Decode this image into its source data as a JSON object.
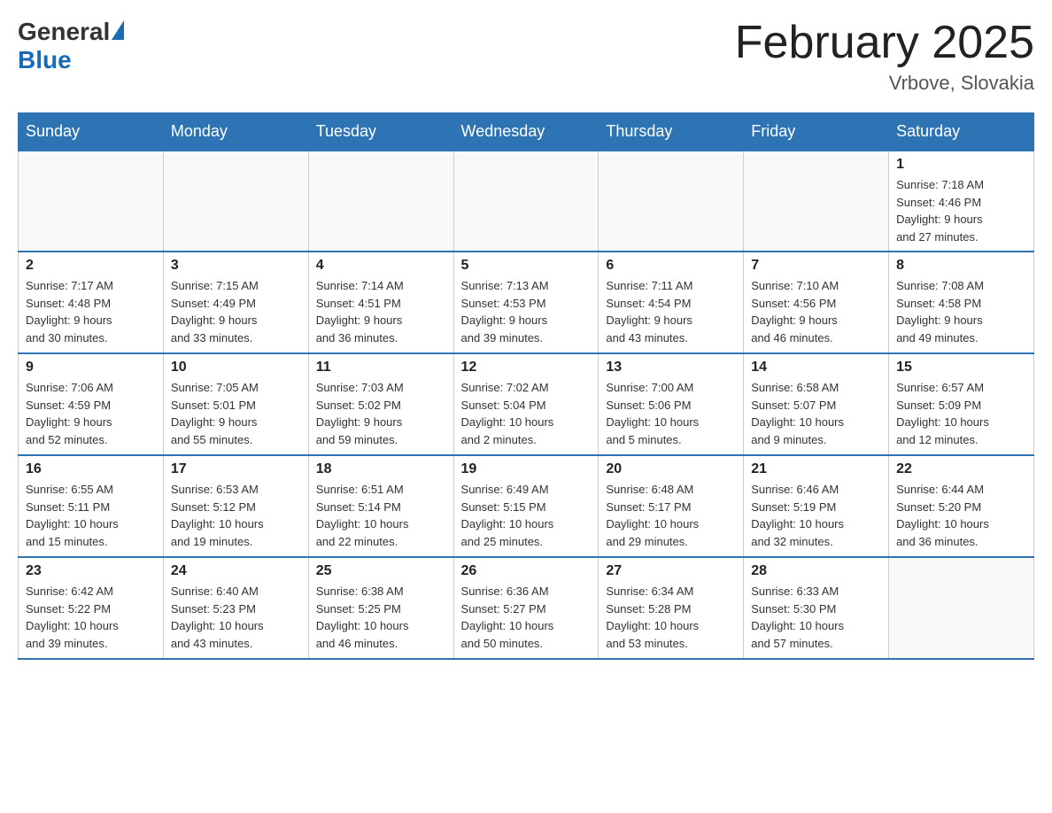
{
  "header": {
    "logo_general": "General",
    "logo_blue": "Blue",
    "month_title": "February 2025",
    "location": "Vrbove, Slovakia"
  },
  "weekdays": [
    "Sunday",
    "Monday",
    "Tuesday",
    "Wednesday",
    "Thursday",
    "Friday",
    "Saturday"
  ],
  "weeks": [
    [
      {
        "day": "",
        "info": ""
      },
      {
        "day": "",
        "info": ""
      },
      {
        "day": "",
        "info": ""
      },
      {
        "day": "",
        "info": ""
      },
      {
        "day": "",
        "info": ""
      },
      {
        "day": "",
        "info": ""
      },
      {
        "day": "1",
        "info": "Sunrise: 7:18 AM\nSunset: 4:46 PM\nDaylight: 9 hours\nand 27 minutes."
      }
    ],
    [
      {
        "day": "2",
        "info": "Sunrise: 7:17 AM\nSunset: 4:48 PM\nDaylight: 9 hours\nand 30 minutes."
      },
      {
        "day": "3",
        "info": "Sunrise: 7:15 AM\nSunset: 4:49 PM\nDaylight: 9 hours\nand 33 minutes."
      },
      {
        "day": "4",
        "info": "Sunrise: 7:14 AM\nSunset: 4:51 PM\nDaylight: 9 hours\nand 36 minutes."
      },
      {
        "day": "5",
        "info": "Sunrise: 7:13 AM\nSunset: 4:53 PM\nDaylight: 9 hours\nand 39 minutes."
      },
      {
        "day": "6",
        "info": "Sunrise: 7:11 AM\nSunset: 4:54 PM\nDaylight: 9 hours\nand 43 minutes."
      },
      {
        "day": "7",
        "info": "Sunrise: 7:10 AM\nSunset: 4:56 PM\nDaylight: 9 hours\nand 46 minutes."
      },
      {
        "day": "8",
        "info": "Sunrise: 7:08 AM\nSunset: 4:58 PM\nDaylight: 9 hours\nand 49 minutes."
      }
    ],
    [
      {
        "day": "9",
        "info": "Sunrise: 7:06 AM\nSunset: 4:59 PM\nDaylight: 9 hours\nand 52 minutes."
      },
      {
        "day": "10",
        "info": "Sunrise: 7:05 AM\nSunset: 5:01 PM\nDaylight: 9 hours\nand 55 minutes."
      },
      {
        "day": "11",
        "info": "Sunrise: 7:03 AM\nSunset: 5:02 PM\nDaylight: 9 hours\nand 59 minutes."
      },
      {
        "day": "12",
        "info": "Sunrise: 7:02 AM\nSunset: 5:04 PM\nDaylight: 10 hours\nand 2 minutes."
      },
      {
        "day": "13",
        "info": "Sunrise: 7:00 AM\nSunset: 5:06 PM\nDaylight: 10 hours\nand 5 minutes."
      },
      {
        "day": "14",
        "info": "Sunrise: 6:58 AM\nSunset: 5:07 PM\nDaylight: 10 hours\nand 9 minutes."
      },
      {
        "day": "15",
        "info": "Sunrise: 6:57 AM\nSunset: 5:09 PM\nDaylight: 10 hours\nand 12 minutes."
      }
    ],
    [
      {
        "day": "16",
        "info": "Sunrise: 6:55 AM\nSunset: 5:11 PM\nDaylight: 10 hours\nand 15 minutes."
      },
      {
        "day": "17",
        "info": "Sunrise: 6:53 AM\nSunset: 5:12 PM\nDaylight: 10 hours\nand 19 minutes."
      },
      {
        "day": "18",
        "info": "Sunrise: 6:51 AM\nSunset: 5:14 PM\nDaylight: 10 hours\nand 22 minutes."
      },
      {
        "day": "19",
        "info": "Sunrise: 6:49 AM\nSunset: 5:15 PM\nDaylight: 10 hours\nand 25 minutes."
      },
      {
        "day": "20",
        "info": "Sunrise: 6:48 AM\nSunset: 5:17 PM\nDaylight: 10 hours\nand 29 minutes."
      },
      {
        "day": "21",
        "info": "Sunrise: 6:46 AM\nSunset: 5:19 PM\nDaylight: 10 hours\nand 32 minutes."
      },
      {
        "day": "22",
        "info": "Sunrise: 6:44 AM\nSunset: 5:20 PM\nDaylight: 10 hours\nand 36 minutes."
      }
    ],
    [
      {
        "day": "23",
        "info": "Sunrise: 6:42 AM\nSunset: 5:22 PM\nDaylight: 10 hours\nand 39 minutes."
      },
      {
        "day": "24",
        "info": "Sunrise: 6:40 AM\nSunset: 5:23 PM\nDaylight: 10 hours\nand 43 minutes."
      },
      {
        "day": "25",
        "info": "Sunrise: 6:38 AM\nSunset: 5:25 PM\nDaylight: 10 hours\nand 46 minutes."
      },
      {
        "day": "26",
        "info": "Sunrise: 6:36 AM\nSunset: 5:27 PM\nDaylight: 10 hours\nand 50 minutes."
      },
      {
        "day": "27",
        "info": "Sunrise: 6:34 AM\nSunset: 5:28 PM\nDaylight: 10 hours\nand 53 minutes."
      },
      {
        "day": "28",
        "info": "Sunrise: 6:33 AM\nSunset: 5:30 PM\nDaylight: 10 hours\nand 57 minutes."
      },
      {
        "day": "",
        "info": ""
      }
    ]
  ]
}
